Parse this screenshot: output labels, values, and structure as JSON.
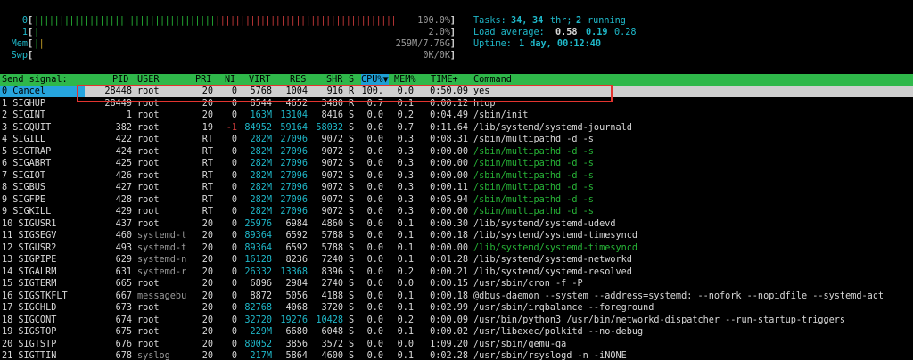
{
  "meters": [
    {
      "label": "0",
      "value": "100.0%",
      "fill": 1.0
    },
    {
      "label": "1",
      "value": "2.0%",
      "fill": 0.02
    },
    {
      "label": "Mem",
      "value": "259M/7.76G",
      "fill": 0.03
    },
    {
      "label": "Swp",
      "value": "0K/0K",
      "fill": 0.0
    }
  ],
  "summary": {
    "tasks_label": "Tasks:",
    "tasks_value": "34,",
    "thr_value": "34",
    "thr_label": "thr;",
    "running_value": "2",
    "running_label": "running",
    "load_label": "Load average:",
    "load1": "0.58",
    "load5": "0.19",
    "load15": "0.28",
    "uptime_label": "Uptime:",
    "uptime_value": "1 day, 00:12:40"
  },
  "header": {
    "signal_title": "Send signal:",
    "columns": [
      "PID",
      "USER",
      "PRI",
      "NI",
      "VIRT",
      "RES",
      "SHR",
      "S",
      "CPU%▼",
      "MEM%",
      "TIME+",
      "Command"
    ]
  },
  "signals": [
    "0 Cancel",
    "1 SIGHUP",
    "2 SIGINT",
    "3 SIGQUIT",
    "4 SIGILL",
    "5 SIGTRAP",
    "6 SIGABRT",
    "7 SIGIOT",
    "8 SIGBUS",
    "9 SIGFPE",
    "9 SIGKILL",
    "10 SIGUSR1",
    "11 SIGSEGV",
    "12 SIGUSR2",
    "13 SIGPIPE",
    "14 SIGALRM",
    "15 SIGTERM",
    "16 SIGSTKFLT",
    "17 SIGCHLD",
    "18 SIGCONT",
    "19 SIGSTOP",
    "20 SIGTSTP",
    "21 SIGTTIN"
  ],
  "processes": [
    {
      "pid": "28448",
      "user": "root",
      "pri": "20",
      "ni": "0",
      "virt": "5768",
      "res": "1004",
      "shr": "916",
      "s": "R",
      "cpu": "100.",
      "mem": "0.0",
      "time": "0:50.09",
      "cmd": "yes"
    },
    {
      "pid": "28449",
      "user": "root",
      "pri": "20",
      "ni": "0",
      "virt": "8544",
      "res": "4652",
      "shr": "3480",
      "s": "R",
      "cpu": "0.7",
      "mem": "0.1",
      "time": "0:00.12",
      "cmd": "htop"
    },
    {
      "pid": "1",
      "user": "root",
      "pri": "20",
      "ni": "0",
      "virt": "163M",
      "res": "13104",
      "shr": "8416",
      "s": "S",
      "cpu": "0.0",
      "mem": "0.2",
      "time": "0:04.49",
      "cmd": "/sbin/init"
    },
    {
      "pid": "382",
      "user": "root",
      "pri": "19",
      "ni": "-1",
      "virt": "84952",
      "res": "59164",
      "shr": "58032",
      "s": "S",
      "cpu": "0.0",
      "mem": "0.7",
      "time": "0:11.64",
      "cmd": "/lib/systemd/systemd-journald"
    },
    {
      "pid": "422",
      "user": "root",
      "pri": "RT",
      "ni": "0",
      "virt": "282M",
      "res": "27096",
      "shr": "9072",
      "s": "S",
      "cpu": "0.0",
      "mem": "0.3",
      "time": "0:08.31",
      "cmd": "/sbin/multipathd -d -s"
    },
    {
      "pid": "424",
      "user": "root",
      "pri": "RT",
      "ni": "0",
      "virt": "282M",
      "res": "27096",
      "shr": "9072",
      "s": "S",
      "cpu": "0.0",
      "mem": "0.3",
      "time": "0:00.00",
      "cmd": "/sbin/multipathd -d -s"
    },
    {
      "pid": "425",
      "user": "root",
      "pri": "RT",
      "ni": "0",
      "virt": "282M",
      "res": "27096",
      "shr": "9072",
      "s": "S",
      "cpu": "0.0",
      "mem": "0.3",
      "time": "0:00.00",
      "cmd": "/sbin/multipathd -d -s"
    },
    {
      "pid": "426",
      "user": "root",
      "pri": "RT",
      "ni": "0",
      "virt": "282M",
      "res": "27096",
      "shr": "9072",
      "s": "S",
      "cpu": "0.0",
      "mem": "0.3",
      "time": "0:00.00",
      "cmd": "/sbin/multipathd -d -s"
    },
    {
      "pid": "427",
      "user": "root",
      "pri": "RT",
      "ni": "0",
      "virt": "282M",
      "res": "27096",
      "shr": "9072",
      "s": "S",
      "cpu": "0.0",
      "mem": "0.3",
      "time": "0:00.11",
      "cmd": "/sbin/multipathd -d -s"
    },
    {
      "pid": "428",
      "user": "root",
      "pri": "RT",
      "ni": "0",
      "virt": "282M",
      "res": "27096",
      "shr": "9072",
      "s": "S",
      "cpu": "0.0",
      "mem": "0.3",
      "time": "0:05.94",
      "cmd": "/sbin/multipathd -d -s"
    },
    {
      "pid": "429",
      "user": "root",
      "pri": "RT",
      "ni": "0",
      "virt": "282M",
      "res": "27096",
      "shr": "9072",
      "s": "S",
      "cpu": "0.0",
      "mem": "0.3",
      "time": "0:00.00",
      "cmd": "/sbin/multipathd -d -s"
    },
    {
      "pid": "437",
      "user": "root",
      "pri": "20",
      "ni": "0",
      "virt": "25976",
      "res": "6984",
      "shr": "4860",
      "s": "S",
      "cpu": "0.0",
      "mem": "0.1",
      "time": "0:00.30",
      "cmd": "/lib/systemd/systemd-udevd"
    },
    {
      "pid": "460",
      "user": "systemd-t",
      "pri": "20",
      "ni": "0",
      "virt": "89364",
      "res": "6592",
      "shr": "5788",
      "s": "S",
      "cpu": "0.0",
      "mem": "0.1",
      "time": "0:00.18",
      "cmd": "/lib/systemd/systemd-timesyncd"
    },
    {
      "pid": "493",
      "user": "systemd-t",
      "pri": "20",
      "ni": "0",
      "virt": "89364",
      "res": "6592",
      "shr": "5788",
      "s": "S",
      "cpu": "0.0",
      "mem": "0.1",
      "time": "0:00.00",
      "cmd": "/lib/systemd/systemd-timesyncd"
    },
    {
      "pid": "629",
      "user": "systemd-n",
      "pri": "20",
      "ni": "0",
      "virt": "16128",
      "res": "8236",
      "shr": "7240",
      "s": "S",
      "cpu": "0.0",
      "mem": "0.1",
      "time": "0:01.28",
      "cmd": "/lib/systemd/systemd-networkd"
    },
    {
      "pid": "631",
      "user": "systemd-r",
      "pri": "20",
      "ni": "0",
      "virt": "26332",
      "res": "13368",
      "shr": "8396",
      "s": "S",
      "cpu": "0.0",
      "mem": "0.2",
      "time": "0:00.21",
      "cmd": "/lib/systemd/systemd-resolved"
    },
    {
      "pid": "665",
      "user": "root",
      "pri": "20",
      "ni": "0",
      "virt": "6896",
      "res": "2984",
      "shr": "2740",
      "s": "S",
      "cpu": "0.0",
      "mem": "0.0",
      "time": "0:00.15",
      "cmd": "/usr/sbin/cron -f -P"
    },
    {
      "pid": "667",
      "user": "messagebu",
      "pri": "20",
      "ni": "0",
      "virt": "8872",
      "res": "5056",
      "shr": "4188",
      "s": "S",
      "cpu": "0.0",
      "mem": "0.1",
      "time": "0:00.18",
      "cmd": "@dbus-daemon --system --address=systemd: --nofork --nopidfile --systemd-act"
    },
    {
      "pid": "673",
      "user": "root",
      "pri": "20",
      "ni": "0",
      "virt": "82768",
      "res": "4068",
      "shr": "3720",
      "s": "S",
      "cpu": "0.0",
      "mem": "0.1",
      "time": "0:02.99",
      "cmd": "/usr/sbin/irqbalance --foreground"
    },
    {
      "pid": "674",
      "user": "root",
      "pri": "20",
      "ni": "0",
      "virt": "32720",
      "res": "19276",
      "shr": "10428",
      "s": "S",
      "cpu": "0.0",
      "mem": "0.2",
      "time": "0:00.09",
      "cmd": "/usr/bin/python3 /usr/bin/networkd-dispatcher --run-startup-triggers"
    },
    {
      "pid": "675",
      "user": "root",
      "pri": "20",
      "ni": "0",
      "virt": "229M",
      "res": "6680",
      "shr": "6048",
      "s": "S",
      "cpu": "0.0",
      "mem": "0.1",
      "time": "0:00.02",
      "cmd": "/usr/libexec/polkitd --no-debug"
    },
    {
      "pid": "676",
      "user": "root",
      "pri": "20",
      "ni": "0",
      "virt": "80052",
      "res": "3856",
      "shr": "3572",
      "s": "S",
      "cpu": "0.0",
      "mem": "0.0",
      "time": "1:09.20",
      "cmd": "/usr/sbin/qemu-ga"
    },
    {
      "pid": "678",
      "user": "syslog",
      "pri": "20",
      "ni": "0",
      "virt": "217M",
      "res": "5864",
      "shr": "4600",
      "s": "S",
      "cpu": "0.0",
      "mem": "0.1",
      "time": "0:02.28",
      "cmd": "/usr/sbin/rsyslogd -n -iNONE"
    }
  ],
  "colors": {
    "terminal_bg": "#000000",
    "header_bar": "#2fb84a",
    "sort_column": "#1e9fd4",
    "selected_signal": "#26a5de",
    "selected_row": "#cfcfcf",
    "highlight_box": "#e3342f"
  }
}
